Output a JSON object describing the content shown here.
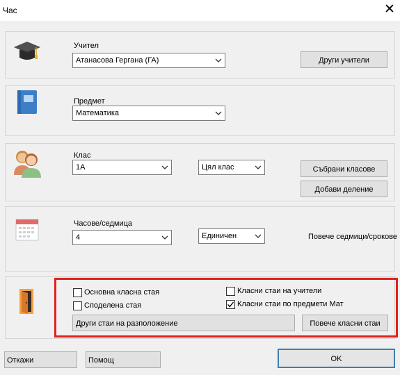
{
  "window": {
    "title": "Час",
    "close_glyph": "✕"
  },
  "teacher": {
    "label": "Учител",
    "value": "Атанасова Гергана (ГА)",
    "other_button": "Други учители",
    "icon": "graduation-cap-icon"
  },
  "subject": {
    "label": "Предмет",
    "value": "Математика",
    "icon": "notebook-icon"
  },
  "class_section": {
    "label": "Клас",
    "value": "1А",
    "scope_value": "Цял клас",
    "joined_button": "Събрани класове",
    "add_division_button": "Добави деление",
    "icon": "people-icon"
  },
  "hours": {
    "label": "Часове/седмица",
    "value": "4",
    "frequency_value": "Единичен",
    "more_weeks_button": "Повече седмици/срокове",
    "icon": "calendar-icon"
  },
  "rooms": {
    "icon": "door-icon",
    "home_room": {
      "label": "Основна класна стая",
      "checked": false
    },
    "shared_room": {
      "label": "Споделена стая",
      "checked": false
    },
    "teacher_rooms": {
      "label": "Класни стаи на учители",
      "checked": false
    },
    "subject_rooms": {
      "label": "Класни стаи по предмети Мат",
      "checked": true
    },
    "other_rooms_button": "Други стаи на разположение",
    "more_rooms_button": "Повече класни стаи",
    "highlight_color": "#e0201b"
  },
  "footer": {
    "cancel_button": "Откажи",
    "help_button": "Помощ",
    "ok_button": "OK"
  }
}
